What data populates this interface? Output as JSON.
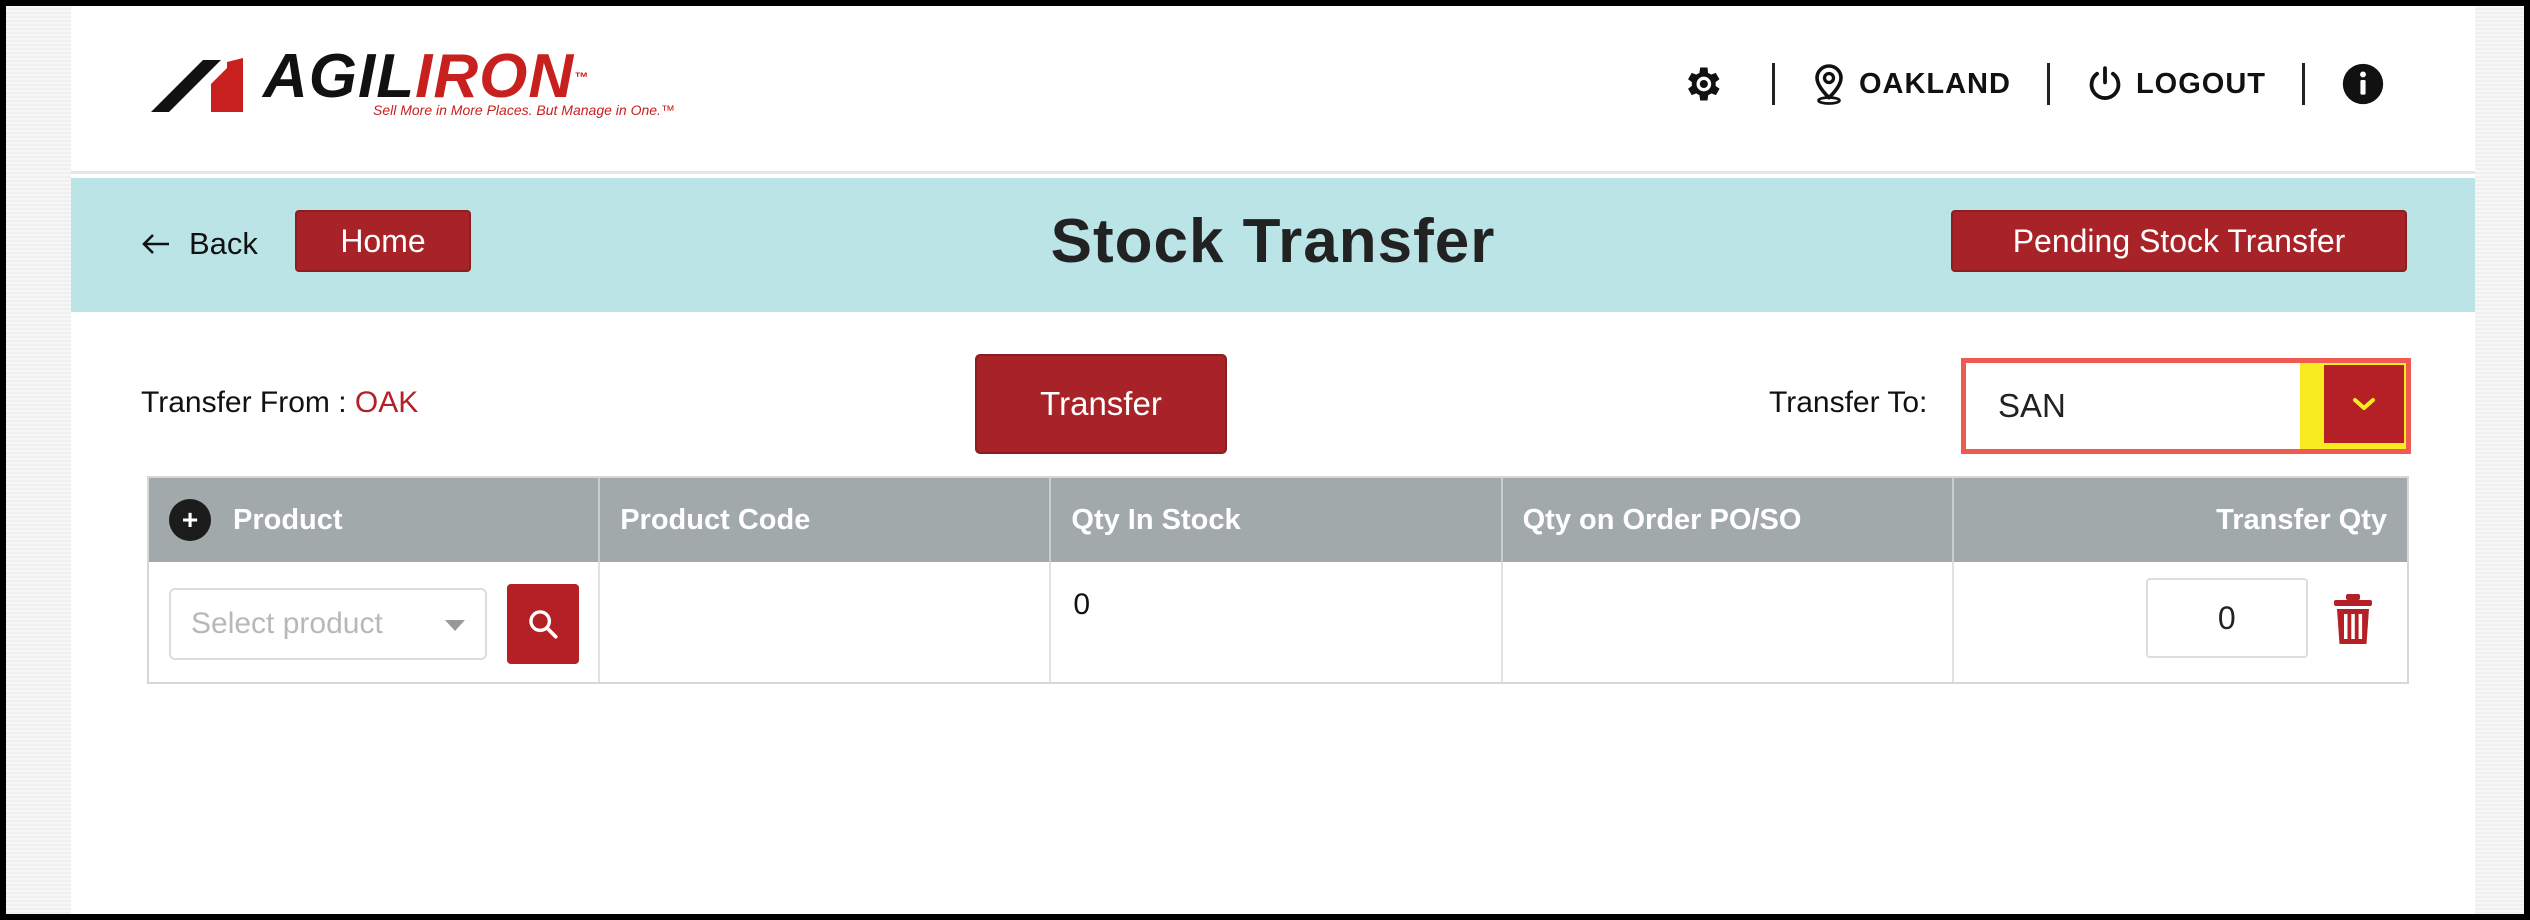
{
  "header": {
    "logo": {
      "word_black": "AGIL",
      "word_red": "IRON",
      "tm": "™",
      "tagline": "Sell More in More Places. But Manage in One.™"
    },
    "location": "OAKLAND",
    "logout": "LOGOUT",
    "icons": {
      "settings": "gear-icon",
      "location": "location-pin-icon",
      "logout": "power-icon",
      "info": "info-icon"
    }
  },
  "banner": {
    "back_label": "Back",
    "home_label": "Home",
    "title": "Stock Transfer",
    "pending_label": "Pending Stock Transfer"
  },
  "transfer": {
    "from_label": "Transfer From : ",
    "from_value": "OAK",
    "transfer_button": "Transfer",
    "to_label": "Transfer To:",
    "to_value": "SAN"
  },
  "table": {
    "add_symbol": "+",
    "columns": [
      "Product",
      "Product Code",
      "Qty In Stock",
      "Qty on Order PO/SO",
      "Transfer Qty"
    ],
    "rows": [
      {
        "product_placeholder": "Select product",
        "product_code": "",
        "qty_in_stock": "0",
        "qty_on_order": "",
        "transfer_qty": "0"
      }
    ]
  },
  "colors": {
    "brand_red": "#a82327",
    "banner_bg": "#bbe4e6",
    "table_header": "#a2a9ab",
    "highlight_yellow": "#f7ec1f",
    "highlight_border": "#ef5a52"
  }
}
